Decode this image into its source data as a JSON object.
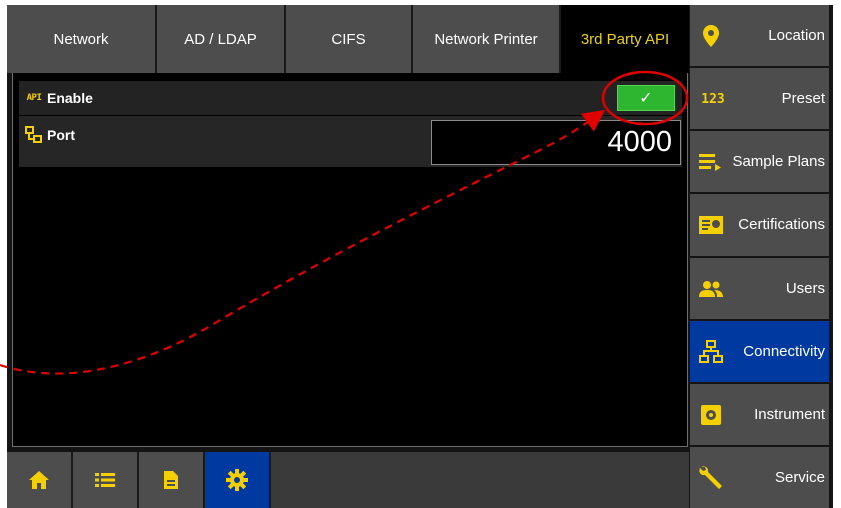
{
  "tabs": [
    {
      "label": "Network",
      "active": false
    },
    {
      "label": "AD / LDAP",
      "active": false
    },
    {
      "label": "CIFS",
      "active": false
    },
    {
      "label": "Network Printer",
      "active": false
    },
    {
      "label": "3rd Party API",
      "active": true
    }
  ],
  "settings": {
    "enable": {
      "icon_text": "API",
      "label": "Enable",
      "checked": true,
      "check_glyph": "✓"
    },
    "port": {
      "icon": "network-node-icon",
      "label": "Port",
      "value": "4000"
    }
  },
  "bottom_tabs": [
    {
      "icon": "home-icon",
      "active": false
    },
    {
      "icon": "list-icon",
      "active": false
    },
    {
      "icon": "document-icon",
      "active": false
    },
    {
      "icon": "gear-icon",
      "active": true
    }
  ],
  "sidebar": [
    {
      "label": "Location",
      "icon": "location-pin-icon",
      "active": false
    },
    {
      "icon_text": "123",
      "label": "Preset",
      "icon": "numeric-123-icon",
      "active": false
    },
    {
      "label": "Sample Plans",
      "icon": "list-arrow-icon",
      "active": false
    },
    {
      "label": "Certifications",
      "icon": "certificate-icon",
      "active": false
    },
    {
      "label": "Users",
      "icon": "users-icon",
      "active": false
    },
    {
      "label": "Connectivity",
      "icon": "network-icon",
      "active": true
    },
    {
      "label": "Instrument",
      "icon": "instrument-icon",
      "active": false
    },
    {
      "label": "Service",
      "icon": "wrench-icon",
      "active": false
    }
  ],
  "colors": {
    "accent_yellow": "#f5d000",
    "active_blue": "#003aa1",
    "check_green": "#2fb630",
    "annotation_red": "#e00000"
  }
}
